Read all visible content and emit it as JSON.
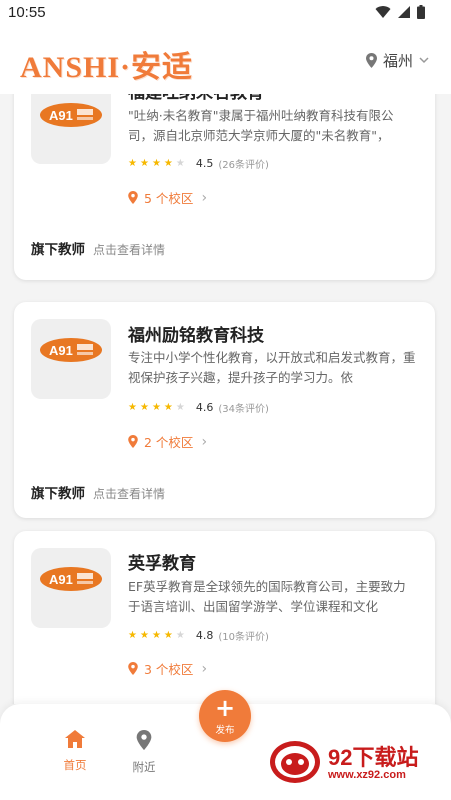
{
  "status_bar": {
    "time": "10:55"
  },
  "header": {
    "logo_text": "ANSHI·安适",
    "city": "福州"
  },
  "cards": [
    {
      "name": "福建吐纳未名教育",
      "description": "\"吐纳·未名教育\"隶属于福州吐纳教育科技有限公司，源自北京师范大学京师大厦的\"未名教育\"，",
      "rating": 4.5,
      "rating_text": "4.5",
      "stars_filled": 4,
      "review_count": "(26条评价)",
      "campus_text": "5 个校区",
      "teacher_label": "旗下教师",
      "teacher_link": "点击查看详情"
    },
    {
      "name": "福州励铭教育科技",
      "description": "专注中小学个性化教育，以开放式和启发式教育，重视保护孩子兴趣，提升孩子的学习力。依",
      "rating": 4.6,
      "rating_text": "4.6",
      "stars_filled": 4,
      "review_count": "(34条评价)",
      "campus_text": "2 个校区",
      "teacher_label": "旗下教师",
      "teacher_link": "点击查看详情"
    },
    {
      "name": "英孚教育",
      "description": "EF英孚教育是全球领先的国际教育公司，主要致力于语言培训、出国留学游学、学位课程和文化",
      "rating": 4.8,
      "rating_text": "4.8",
      "stars_filled": 4,
      "review_count": "(10条评价)",
      "campus_text": "3 个校区"
    }
  ],
  "bottom_nav": {
    "home_label": "首页",
    "nearby_label": "附近",
    "publish_label": "发布"
  },
  "watermark": {
    "title": "92下载站",
    "url": "www.xz92.com"
  },
  "colors": {
    "accent": "#f07b3a",
    "star": "#f6b800",
    "watermark": "#c81c1c"
  }
}
